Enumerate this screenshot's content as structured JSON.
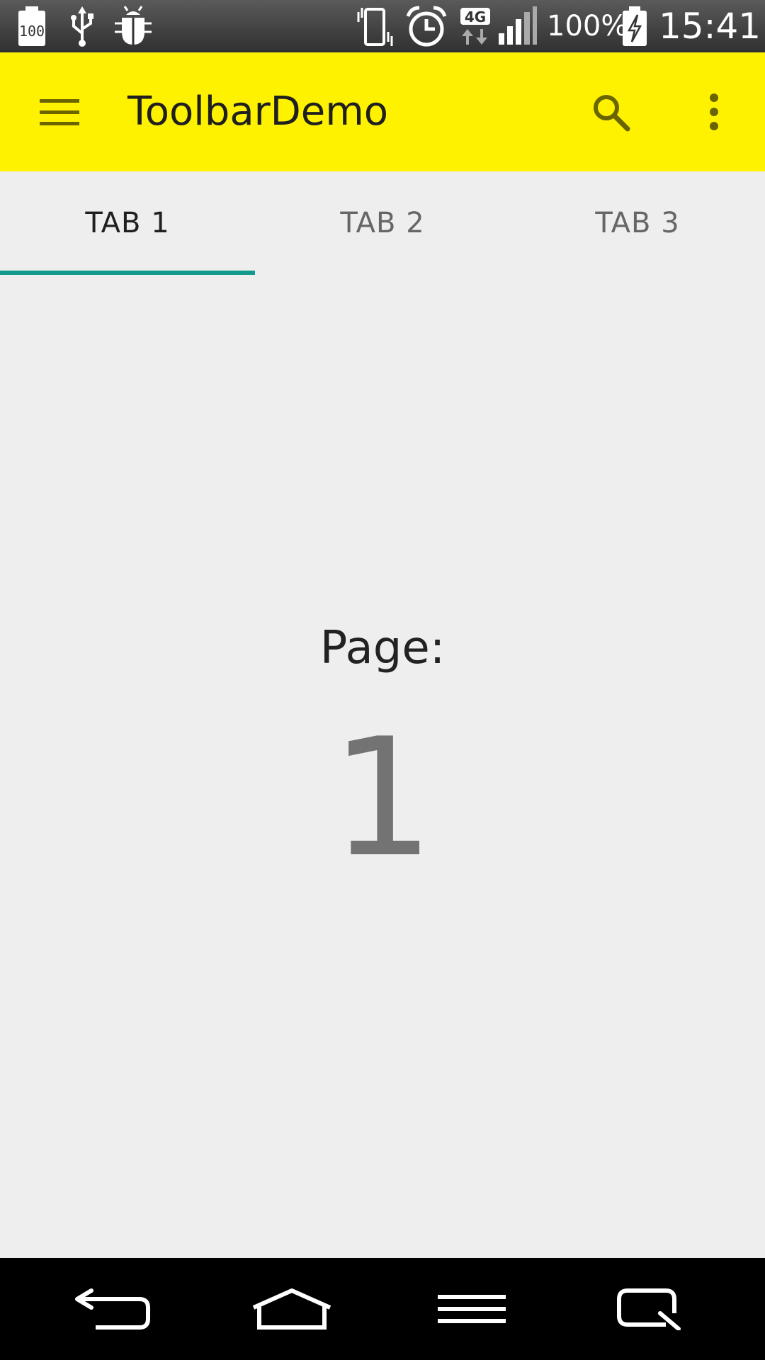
{
  "status_bar": {
    "battery_saver_badge": "100",
    "battery_percent": "100%",
    "time": "15:41",
    "network_type": "4G",
    "icons": [
      "battery-saver-icon",
      "usb-icon",
      "debug-bug-icon",
      "vibrate-icon",
      "alarm-icon",
      "network-4g-icon",
      "signal-icon",
      "battery-charging-icon"
    ]
  },
  "toolbar": {
    "title": "ToolbarDemo",
    "background_color": "#fff200",
    "icons": [
      "menu-icon",
      "search-icon",
      "overflow-menu-icon"
    ]
  },
  "tabs": {
    "items": [
      {
        "label": "TAB 1",
        "selected": true
      },
      {
        "label": "TAB 2",
        "selected": false
      },
      {
        "label": "TAB 3",
        "selected": false
      }
    ],
    "indicator_color": "#119a8c"
  },
  "content": {
    "page_label": "Page:",
    "page_number": "1"
  },
  "nav_bar": {
    "icons": [
      "back-icon",
      "home-icon",
      "menu-lines-icon",
      "quick-memo-icon"
    ]
  }
}
